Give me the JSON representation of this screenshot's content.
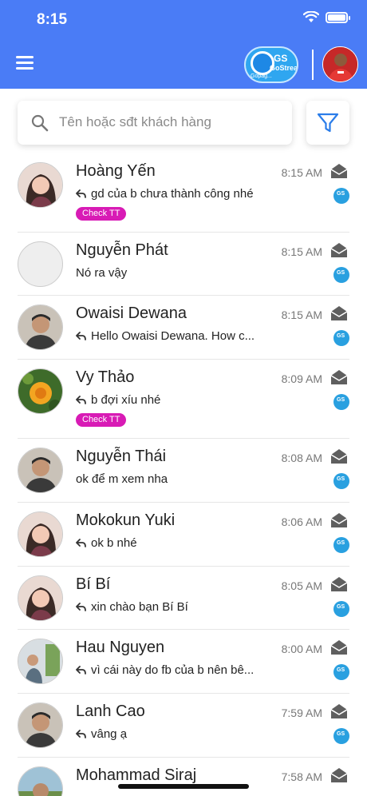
{
  "status_bar": {
    "time": "8:15"
  },
  "header": {
    "page_logo": {
      "badge": "GS",
      "name": "GoStream",
      "sub": "Gopag..."
    },
    "colors": {
      "primary": "#4a7cf6",
      "tag": "#d81bb5",
      "badge": "#29a0e0"
    }
  },
  "search": {
    "placeholder": "Tên hoặc sđt khách hàng",
    "value": ""
  },
  "conversations": [
    {
      "name": "Hoàng Yến",
      "time": "8:15 AM",
      "preview": "gd của b chưa thành công nhé",
      "replied": true,
      "tag": "Check TT",
      "avatar": "photo-woman"
    },
    {
      "name": "Nguyễn Phát",
      "time": "8:15 AM",
      "preview": "Nó ra vậy",
      "replied": false,
      "tag": "",
      "avatar": "blank"
    },
    {
      "name": "Owaisi Dewana",
      "time": "8:15 AM",
      "preview": "Hello Owaisi Dewana. How c...",
      "replied": true,
      "tag": "",
      "avatar": "photo-man"
    },
    {
      "name": "Vy Thảo",
      "time": "8:09 AM",
      "preview": "b đợi xíu nhé",
      "replied": true,
      "tag": "Check TT",
      "avatar": "photo-flower"
    },
    {
      "name": "Nguyễn Thái",
      "time": "8:08 AM",
      "preview": "ok để m xem nha",
      "replied": false,
      "tag": "",
      "avatar": "photo-man"
    },
    {
      "name": "Mokokun Yuki",
      "time": "8:06 AM",
      "preview": "ok b nhé",
      "replied": true,
      "tag": "",
      "avatar": "photo-woman"
    },
    {
      "name": "Bí Bí",
      "time": "8:05 AM",
      "preview": "xin chào bạn Bí Bí",
      "replied": true,
      "tag": "",
      "avatar": "photo-woman"
    },
    {
      "name": "Hau Nguyen",
      "time": "8:00 AM",
      "preview": "vì cái này do fb của b nên bê...",
      "replied": true,
      "tag": "",
      "avatar": "photo-group"
    },
    {
      "name": "Lanh Cao",
      "time": "7:59 AM",
      "preview": "vâng ạ",
      "replied": true,
      "tag": "",
      "avatar": "photo-man"
    },
    {
      "name": "Mohammad Siraj",
      "time": "7:58 AM",
      "preview": "",
      "replied": false,
      "tag": "",
      "avatar": "photo-outdoor"
    }
  ],
  "source_badge_text": "GS"
}
